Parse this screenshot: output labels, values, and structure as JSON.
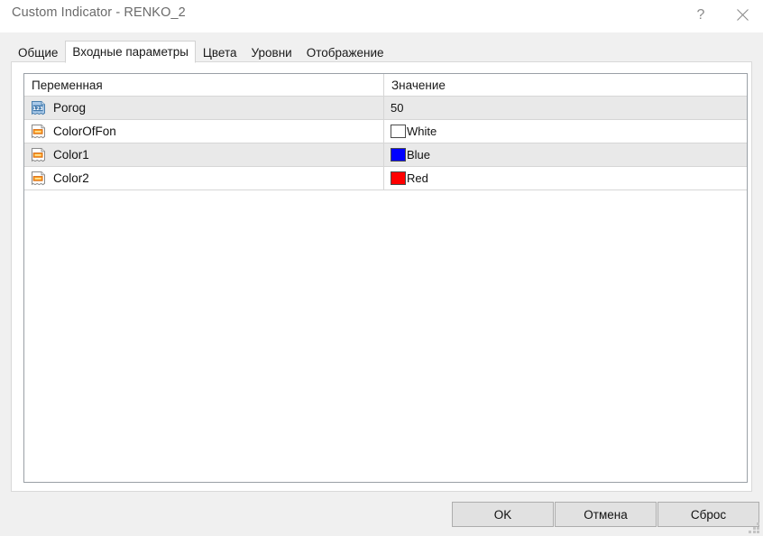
{
  "window": {
    "title": "Custom Indicator - RENKO_2",
    "help_glyph": "?",
    "close_glyph": "✕"
  },
  "tabs": [
    {
      "label": "Общие",
      "active": false
    },
    {
      "label": "Входные параметры",
      "active": true
    },
    {
      "label": "Цвета",
      "active": false
    },
    {
      "label": "Уровни",
      "active": false
    },
    {
      "label": "Отображение",
      "active": false
    }
  ],
  "table": {
    "columns": {
      "variable": "Переменная",
      "value": "Значение"
    },
    "rows": [
      {
        "name": "Porog",
        "value": "50",
        "icon": "number-123-icon",
        "value_type": "number",
        "swatch": ""
      },
      {
        "name": "ColorOfFon",
        "value": "White",
        "icon": "color-swatch-icon",
        "value_type": "color",
        "swatch": "#ffffff"
      },
      {
        "name": "Color1",
        "value": "Blue",
        "icon": "color-swatch-icon",
        "value_type": "color",
        "swatch": "#0000ff"
      },
      {
        "name": "Color2",
        "value": "Red",
        "icon": "color-swatch-icon",
        "value_type": "color",
        "swatch": "#ff0000"
      }
    ]
  },
  "footer": {
    "ok": "OK",
    "cancel": "Отмена",
    "reset": "Сброс"
  }
}
